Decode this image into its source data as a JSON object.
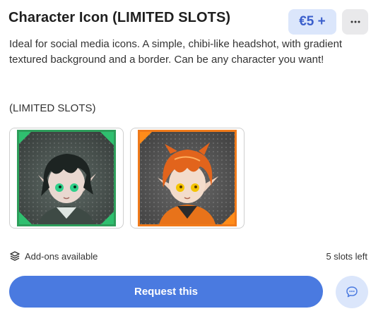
{
  "listing": {
    "title": "Character Icon (LIMITED SLOTS)",
    "price": "€5 +",
    "description": "Ideal for social media icons. A simple, chibi-like headshot, with gradient textured background and a border. Can be any character you want!",
    "limited_note": "(LIMITED SLOTS)"
  },
  "actions": {
    "more_icon": "ellipsis-icon",
    "request_label": "Request this",
    "chat_icon": "chat-bubble-icon"
  },
  "gallery": [
    {
      "name": "dark-haired elf character icon",
      "border_color": "#2e9e5b",
      "accent": "#2fbf6f"
    },
    {
      "name": "orange-haired elf character icon",
      "border_color": "#f07a1a",
      "accent": "#ff8c1a"
    }
  ],
  "footer": {
    "addons_icon": "layers-icon",
    "addons_label": "Add-ons available",
    "slots_left": "5 slots left"
  },
  "colors": {
    "accent": "#4a7ae0",
    "badge_bg": "#dbe6fb",
    "badge_text": "#3b5fcc"
  }
}
